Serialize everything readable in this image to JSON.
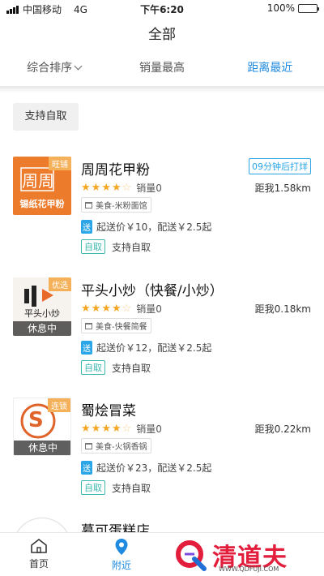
{
  "status_bar": {
    "carrier": "中国移动",
    "network": "4G",
    "time": "下午6:20",
    "battery_text": "100%",
    "battery_level": 1.0
  },
  "page_title": "全部",
  "sort_tabs": [
    {
      "label": "综合排序",
      "has_dropdown": true,
      "active": false
    },
    {
      "label": "销量最高",
      "active": false
    },
    {
      "label": "距离最近",
      "active": true
    }
  ],
  "filter_chip": "支持自取",
  "stores": [
    {
      "name": "周周花甲粉",
      "logo_lines": [
        "周周",
        "锡纸花甲粉"
      ],
      "corner_tag": "旺铺",
      "prep_tag": "09分钟后打烊",
      "rating": 4,
      "sales": "销量0",
      "distance": "距我1.58km",
      "category": "美食-米粉面馆",
      "delivery_badge": "送",
      "delivery_text": "起送价￥10，配送￥2.5起",
      "pickup_badge": "自取",
      "pickup_text": "支持自取",
      "status_overlay": ""
    },
    {
      "name": "平头小炒（快餐/小炒）",
      "logo_lines": [
        "平头小炒"
      ],
      "corner_tag": "优选",
      "prep_tag": "",
      "rating": 4,
      "sales": "销量0",
      "distance": "距我0.18km",
      "category": "美食-快餐简餐",
      "delivery_badge": "送",
      "delivery_text": "起送价￥12，配送￥2.5起",
      "pickup_badge": "自取",
      "pickup_text": "支持自取",
      "status_overlay": "休息中"
    },
    {
      "name": "蜀烩冒菜",
      "logo_lines": [
        "S"
      ],
      "corner_tag": "连锁",
      "prep_tag": "",
      "rating": 4,
      "sales": "销量0",
      "distance": "距我0.22km",
      "category": "美食-火锅香锅",
      "delivery_badge": "送",
      "delivery_text": "起送价￥23，配送￥2.5起",
      "pickup_badge": "自取",
      "pickup_text": "支持自取",
      "status_overlay": "休息中"
    },
    {
      "name": "慕可蛋糕店"
    }
  ],
  "bottom_nav": [
    {
      "label": "首页",
      "icon": "home-icon",
      "active": false
    },
    {
      "label": "附近",
      "icon": "location-pin-icon",
      "active": true
    }
  ],
  "watermark": {
    "text": "清道夫",
    "url": "WWW.QDFUJI.COM"
  },
  "colors": {
    "accent": "#1e8ae0",
    "star": "#f5a623",
    "delivery": "#2aa5e8",
    "pickup": "#3cb8b0"
  }
}
